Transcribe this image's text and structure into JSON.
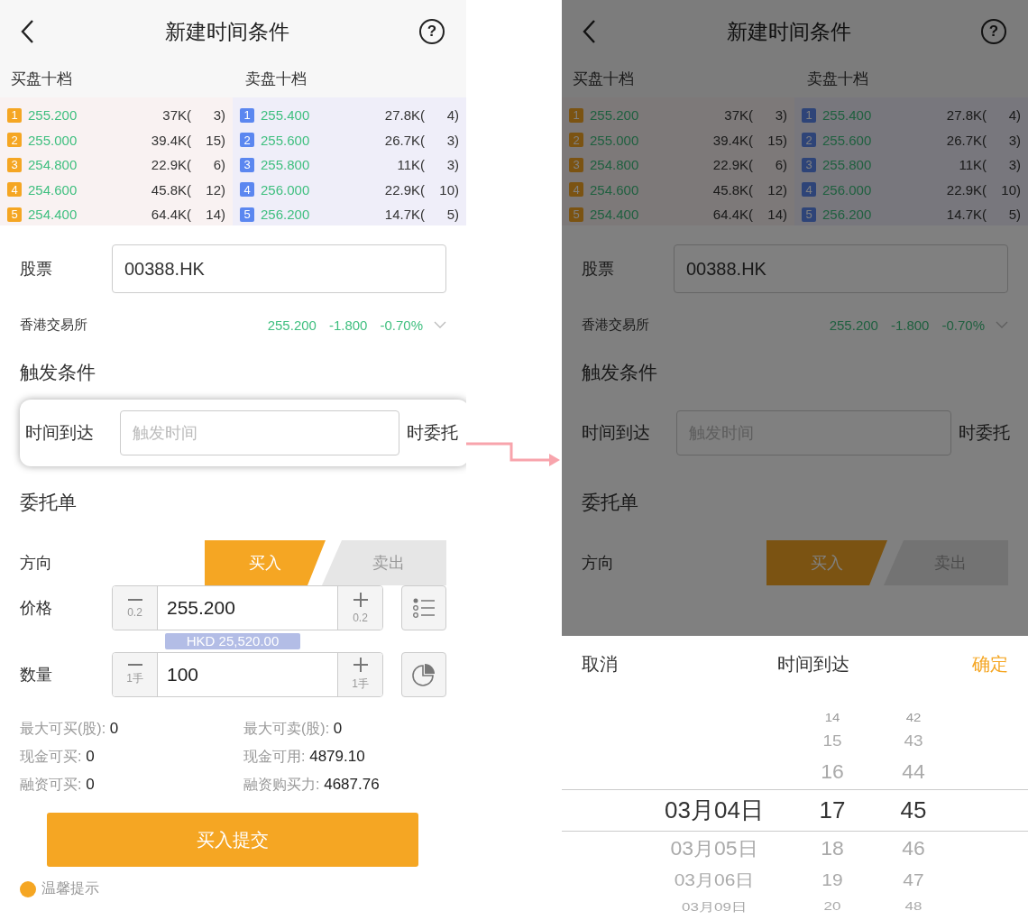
{
  "left_screen": {
    "dimmed": false,
    "nav": {
      "title": "新建时间条件",
      "help": "?"
    },
    "order_book": {
      "bid_title": "买盘十档",
      "ask_title": "卖盘十档",
      "bids": [
        {
          "rank": "1",
          "price": "255.200",
          "volume": "37K(",
          "count": "3)"
        },
        {
          "rank": "2",
          "price": "255.000",
          "volume": "39.4K(",
          "count": "15)"
        },
        {
          "rank": "3",
          "price": "254.800",
          "volume": "22.9K(",
          "count": "6)"
        },
        {
          "rank": "4",
          "price": "254.600",
          "volume": "45.8K(",
          "count": "12)"
        },
        {
          "rank": "5",
          "price": "254.400",
          "volume": "64.4K(",
          "count": "14)"
        }
      ],
      "asks": [
        {
          "rank": "1",
          "price": "255.400",
          "volume": "27.8K(",
          "count": "4)"
        },
        {
          "rank": "2",
          "price": "255.600",
          "volume": "26.7K(",
          "count": "3)"
        },
        {
          "rank": "3",
          "price": "255.800",
          "volume": "11K(",
          "count": "3)"
        },
        {
          "rank": "4",
          "price": "256.000",
          "volume": "22.9K(",
          "count": "10)"
        },
        {
          "rank": "5",
          "price": "256.200",
          "volume": "14.7K(",
          "count": "5)"
        }
      ]
    },
    "stock": {
      "label": "股票",
      "value": "00388.HK"
    },
    "quote": {
      "exchange": "香港交易所",
      "price": "255.200",
      "change": "-1.800",
      "change_pct": "-0.70%"
    },
    "trigger": {
      "heading": "触发条件",
      "label": "时间到达",
      "placeholder": "触发时间",
      "suffix": "时委托",
      "highlighted": true
    },
    "order": {
      "heading": "委托单",
      "direction_label": "方向",
      "directions": [
        {
          "label": "买入",
          "selected": true
        },
        {
          "label": "卖出",
          "selected": false
        }
      ],
      "price": {
        "label": "价格",
        "value": "255.200",
        "minus_step": "0.2",
        "plus_step": "0.2",
        "amount": "HKD 25,520.00"
      },
      "quantity": {
        "label": "数量",
        "value": "100",
        "minus_step": "1手",
        "plus_step": "1手"
      }
    },
    "stats": [
      {
        "label": "最大可买(股):",
        "value": "0"
      },
      {
        "label": "最大可卖(股):",
        "value": "0"
      },
      {
        "label": "现金可买:",
        "value": "0"
      },
      {
        "label": "现金可用:",
        "value": "4879.10"
      },
      {
        "label": "融资可买:",
        "value": "0"
      },
      {
        "label": "融资购买力:",
        "value": "4687.76"
      }
    ],
    "submit": "买入提交",
    "notice": "温馨提示"
  },
  "right_screen": {
    "dimmed": true,
    "nav": {
      "title": "新建时间条件",
      "help": "?"
    },
    "order_book": {
      "bid_title": "买盘十档",
      "ask_title": "卖盘十档",
      "bids": [
        {
          "rank": "1",
          "price": "255.200",
          "volume": "37K(",
          "count": "3)"
        },
        {
          "rank": "2",
          "price": "255.000",
          "volume": "39.4K(",
          "count": "15)"
        },
        {
          "rank": "3",
          "price": "254.800",
          "volume": "22.9K(",
          "count": "6)"
        },
        {
          "rank": "4",
          "price": "254.600",
          "volume": "45.8K(",
          "count": "12)"
        },
        {
          "rank": "5",
          "price": "254.400",
          "volume": "64.4K(",
          "count": "14)"
        }
      ],
      "asks": [
        {
          "rank": "1",
          "price": "255.400",
          "volume": "27.8K(",
          "count": "4)"
        },
        {
          "rank": "2",
          "price": "255.600",
          "volume": "26.7K(",
          "count": "3)"
        },
        {
          "rank": "3",
          "price": "255.800",
          "volume": "11K(",
          "count": "3)"
        },
        {
          "rank": "4",
          "price": "256.000",
          "volume": "22.9K(",
          "count": "10)"
        },
        {
          "rank": "5",
          "price": "256.200",
          "volume": "14.7K(",
          "count": "5)"
        }
      ]
    },
    "stock": {
      "label": "股票",
      "value": "00388.HK"
    },
    "quote": {
      "exchange": "香港交易所",
      "price": "255.200",
      "change": "-1.800",
      "change_pct": "-0.70%"
    },
    "trigger": {
      "heading": "触发条件",
      "label": "时间到达",
      "placeholder": "触发时间",
      "suffix": "时委托",
      "highlighted": false
    },
    "order": {
      "heading": "委托单",
      "direction_label": "方向",
      "directions": [
        {
          "label": "买入",
          "selected": true
        },
        {
          "label": "卖出",
          "selected": false
        }
      ]
    }
  },
  "picker": {
    "cancel": "取消",
    "title": "时间到达",
    "confirm": "确定",
    "columns": [
      {
        "kind": "date",
        "items": [
          {
            "label": "03月04日",
            "selected": true
          },
          {
            "label": "03月05日",
            "selected": false
          },
          {
            "label": "03月06日",
            "selected": false
          },
          {
            "label": "03月09日",
            "selected": false
          }
        ]
      },
      {
        "kind": "hour",
        "items": [
          {
            "label": "14",
            "selected": false
          },
          {
            "label": "15",
            "selected": false
          },
          {
            "label": "16",
            "selected": false
          },
          {
            "label": "17",
            "selected": true
          },
          {
            "label": "18",
            "selected": false
          },
          {
            "label": "19",
            "selected": false
          },
          {
            "label": "20",
            "selected": false
          }
        ]
      },
      {
        "kind": "minute",
        "items": [
          {
            "label": "42",
            "selected": false
          },
          {
            "label": "43",
            "selected": false
          },
          {
            "label": "44",
            "selected": false
          },
          {
            "label": "45",
            "selected": true
          },
          {
            "label": "46",
            "selected": false
          },
          {
            "label": "47",
            "selected": false
          },
          {
            "label": "48",
            "selected": false
          }
        ]
      }
    ]
  }
}
